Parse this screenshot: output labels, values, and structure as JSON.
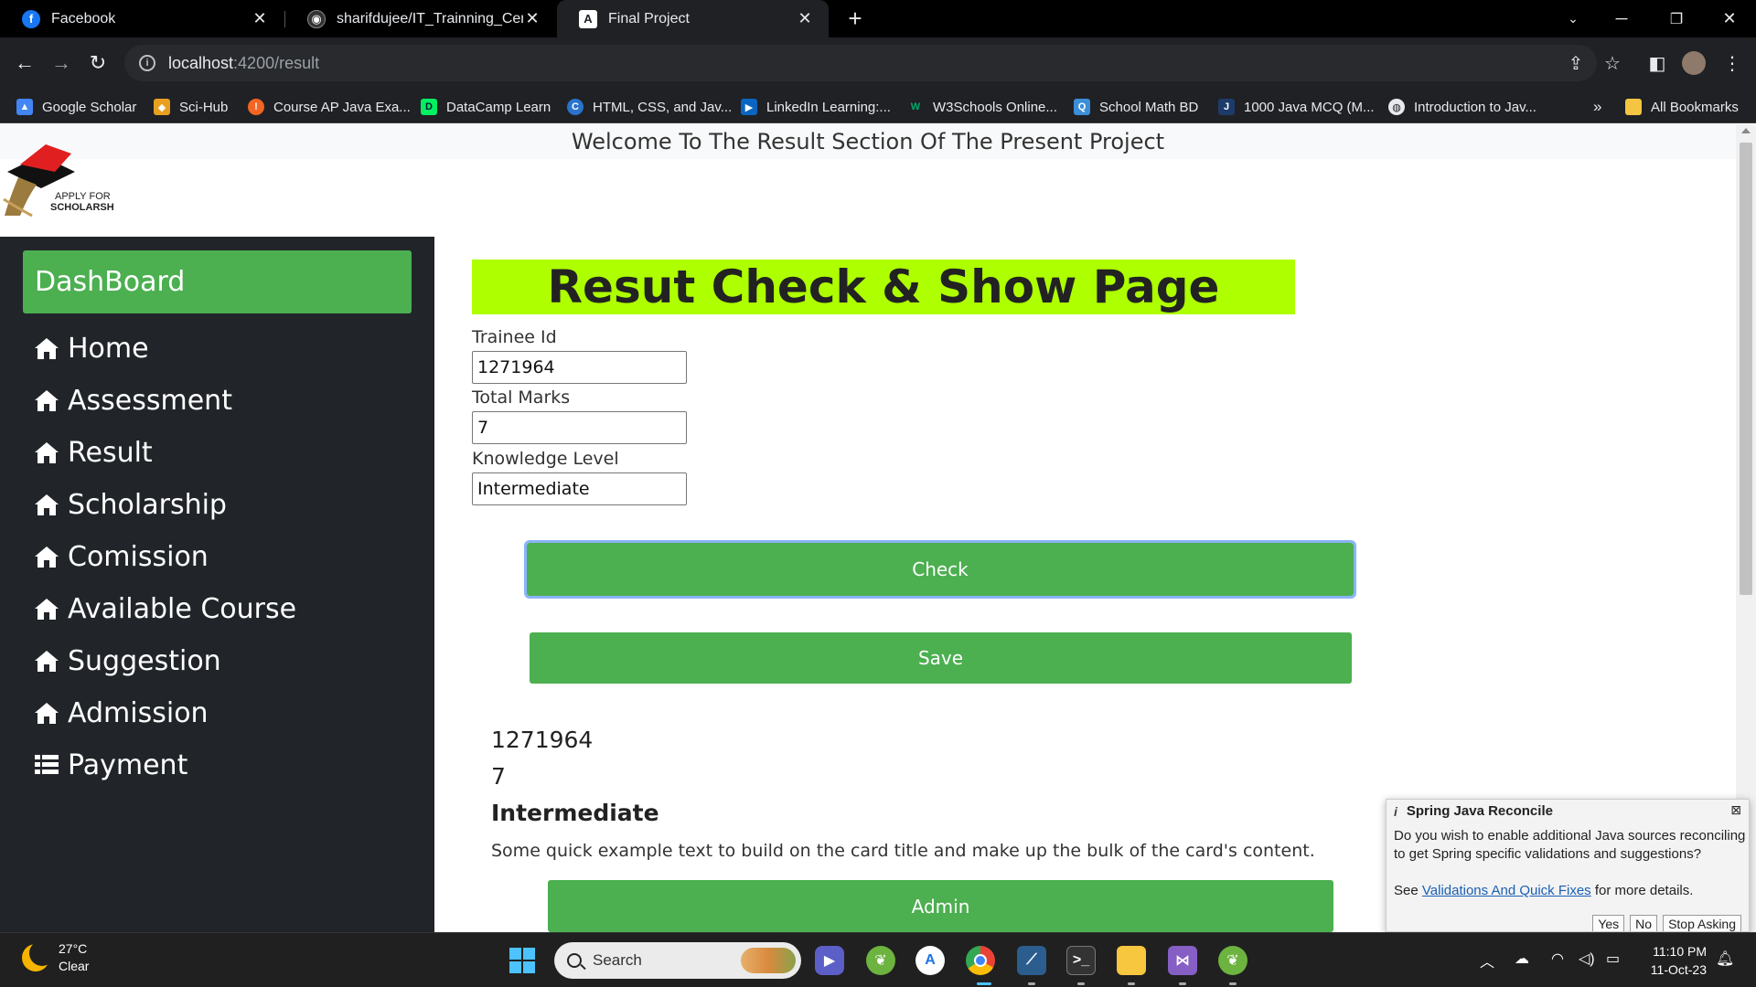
{
  "browser": {
    "tabs": [
      {
        "title": "Facebook",
        "icon": "facebook-icon"
      },
      {
        "title": "sharifdujee/IT_Trainning_Center",
        "icon": "github-icon"
      },
      {
        "title": "Final Project",
        "icon": "angular-icon"
      }
    ],
    "url_host": "localhost",
    "url_path": ":4200/result",
    "bookmarks": [
      "Google Scholar",
      "Sci-Hub",
      "Course AP Java Exa...",
      "DataCamp Learn",
      "HTML, CSS, and Jav...",
      "LinkedIn Learning:...",
      "W3Schools Online...",
      "School Math BD",
      "1000 Java MCQ (M...",
      "Introduction to Jav..."
    ],
    "more_bookmarks": "»",
    "all_bookmarks": "All Bookmarks"
  },
  "page": {
    "welcome": "Welcome To The Result Section Of The Present Project",
    "logo_line1": "APPLY FOR",
    "logo_line2": "SCHOLARSHIPS",
    "dashboard_label": "DashBoard",
    "nav": [
      {
        "label": "Home",
        "icon": "home-icon"
      },
      {
        "label": "Assessment",
        "icon": "home-icon"
      },
      {
        "label": "Result",
        "icon": "home-icon"
      },
      {
        "label": "Scholarship",
        "icon": "home-icon"
      },
      {
        "label": "Comission",
        "icon": "home-icon"
      },
      {
        "label": "Available Course",
        "icon": "home-icon"
      },
      {
        "label": "Suggestion",
        "icon": "home-icon"
      },
      {
        "label": "Admission",
        "icon": "home-icon"
      },
      {
        "label": "Payment",
        "icon": "list-icon"
      }
    ],
    "heading": "Resut Check & Show Page",
    "form": {
      "trainee_id_label": "Trainee Id",
      "trainee_id_value": "1271964",
      "total_marks_label": "Total Marks",
      "total_marks_value": "7",
      "knowledge_level_label": "Knowledge Level",
      "knowledge_level_value": "Intermediate"
    },
    "check_label": "Check",
    "save_label": "Save",
    "card": {
      "id": "1271964",
      "marks": "7",
      "level": "Intermediate",
      "text": "Some quick example text to build on the card title and make up the bulk of the card's content."
    },
    "admin_label": "Admin"
  },
  "notification": {
    "title": "Spring Java Reconcile",
    "body": "Do you wish to enable additional Java sources reconciling to get Spring specific validations and suggestions?",
    "see": "See",
    "link": "Validations And Quick Fixes",
    "after_link": "for more details.",
    "yes": "Yes",
    "no": "No",
    "stop": "Stop Asking"
  },
  "taskbar": {
    "temperature": "27°C",
    "condition": "Clear",
    "search_placeholder": "Search",
    "time": "11:10 PM",
    "date": "11-Oct-23"
  },
  "colors": {
    "accent_green": "#4caf50",
    "heading_bg": "#aeff00",
    "sidebar_bg": "#212529"
  }
}
